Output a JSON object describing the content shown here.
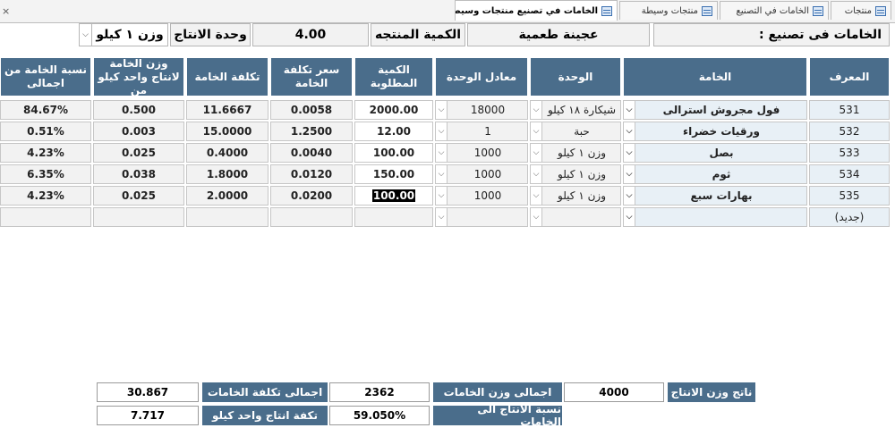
{
  "close_glyph": "×",
  "tabs": [
    {
      "label": "منتجات",
      "active": false
    },
    {
      "label": "الخامات في التصنيع",
      "active": false
    },
    {
      "label": "منتجات وسيطة",
      "active": false
    },
    {
      "label": "الخامات في تصنيع منتجات وسيطة",
      "active": true
    }
  ],
  "header": {
    "label_making": "الخامات فى تصنيع :",
    "product_name": "عجينة طعمية",
    "label_qty": "الكمية المنتجه",
    "qty_value": "4.00",
    "label_unit": "وحدة الانتاج",
    "unit_value": "وزن ١ كيلو"
  },
  "columns": [
    "المعرف",
    "الخامة",
    "الوحدة",
    "معادل الوحدة",
    "الكمية المطلوبة",
    "سعر تكلفة الخامة",
    "تكلفة الخامة",
    "وزن الخامة لانتاج واحد كيلو من",
    "نسبة الخامة من اجمالى"
  ],
  "rows": [
    {
      "id": "531",
      "material": "فول مجروش استرالى",
      "unit": "شيكارة ١٨ كيلو",
      "equiv": "18000",
      "qty": "2000.00",
      "unit_cost": "0.0058",
      "cost": "11.6667",
      "weight_per_kg": "0.500",
      "pct": "84.67%"
    },
    {
      "id": "532",
      "material": "ورقيات خضراء",
      "unit": "حبة",
      "equiv": "1",
      "qty": "12.00",
      "unit_cost": "1.2500",
      "cost": "15.0000",
      "weight_per_kg": "0.003",
      "pct": "0.51%"
    },
    {
      "id": "533",
      "material": "بصل",
      "unit": "وزن ١ كيلو",
      "equiv": "1000",
      "qty": "100.00",
      "unit_cost": "0.0040",
      "cost": "0.4000",
      "weight_per_kg": "0.025",
      "pct": "4.23%"
    },
    {
      "id": "534",
      "material": "ثوم",
      "unit": "وزن ١ كيلو",
      "equiv": "1000",
      "qty": "150.00",
      "unit_cost": "0.0120",
      "cost": "1.8000",
      "weight_per_kg": "0.038",
      "pct": "6.35%"
    },
    {
      "id": "535",
      "material": "بهارات سبع",
      "unit": "وزن ١ كيلو",
      "equiv": "1000",
      "qty": "100.00",
      "unit_cost": "0.0200",
      "cost": "2.0000",
      "weight_per_kg": "0.025",
      "pct": "4.23%"
    }
  ],
  "new_row_label": "(جديد)",
  "dropdown_glyph": "⌵",
  "footer": {
    "output_weight_label": "ناتج وزن الانتاج",
    "output_weight_value": "4000",
    "total_weight_label": "اجمالى وزن الخامات",
    "total_weight_value": "2362",
    "total_cost_label": "اجمالى تكلفة الخامات",
    "total_cost_value": "30.867",
    "yield_label": "نسبة الانتاج الى الخامات",
    "yield_value": "59.050%",
    "cost_per_kg_label": "تكفة انتاج واحد كيلو",
    "cost_per_kg_value": "7.717"
  }
}
